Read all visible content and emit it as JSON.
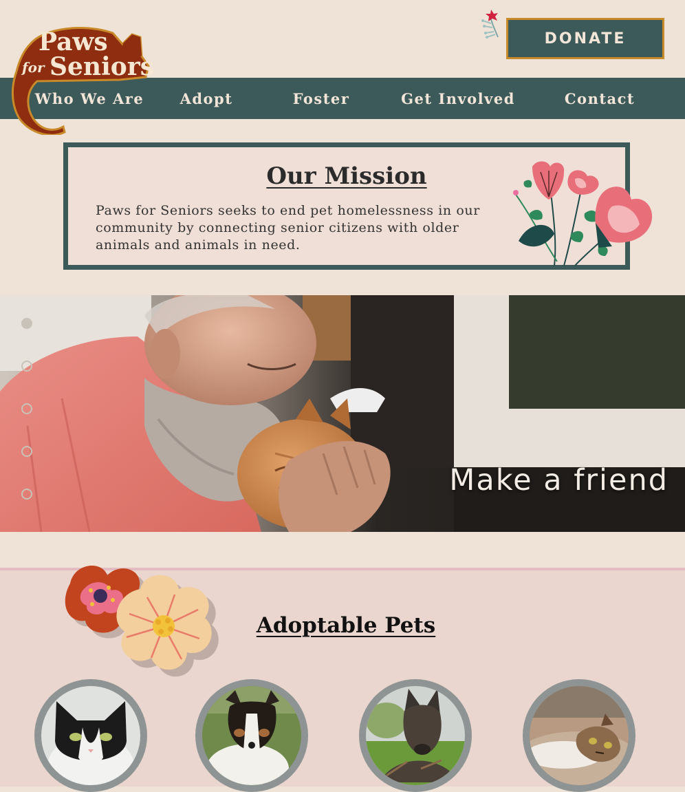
{
  "brand": {
    "logo_line1": "Paws",
    "logo_line2_prefix": "for",
    "logo_line2": "Seniors",
    "colors": {
      "teal": "#3d5a5b",
      "rust": "#8e2d10",
      "gold": "#c98a2a",
      "cream": "#efe3d7",
      "pink": "#ead6cf"
    }
  },
  "header": {
    "donate_label": "DONATE"
  },
  "nav": {
    "items": [
      {
        "label": "Who We Are"
      },
      {
        "label": "Adopt"
      },
      {
        "label": "Foster"
      },
      {
        "label": "Get Involved"
      },
      {
        "label": "Contact"
      }
    ]
  },
  "mission": {
    "title": "Our Mission",
    "body": "Paws for Seniors seeks to end pet homelessness in our community by connecting senior citizens with older animals and animals in need."
  },
  "hero": {
    "tagline": "Make a friend",
    "slides_total": 5,
    "active_slide": 1
  },
  "adoptable": {
    "title": "Adoptable Pets",
    "pets": [
      {
        "kind": "cat",
        "coat": "black and white"
      },
      {
        "kind": "dog",
        "coat": "white, black and tan terrier"
      },
      {
        "kind": "dog",
        "coat": "brindle shepherd"
      },
      {
        "kind": "cat",
        "coat": "tabby and white"
      }
    ]
  }
}
